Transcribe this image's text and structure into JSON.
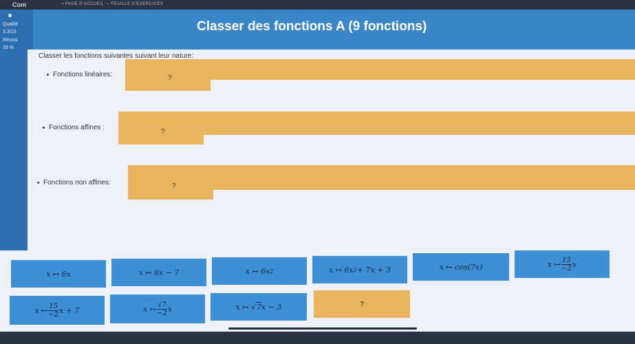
{
  "topbar": {
    "app": "Com",
    "crumb": "▪ PAGE D'ACCUEIL  —  FEUILLE D'EXERCICES"
  },
  "sidebar": {
    "label1": "Qualité",
    "value1": "3.3/10",
    "label2": "Réussi",
    "value2": "33 %"
  },
  "header": {
    "title": "Classer des fonctions A (9 fonctions)"
  },
  "instructions": "Classer les fonctions suivantes suivant leur nature:",
  "categories": [
    {
      "label": "Fonctions linéaires:",
      "placeholder": "?"
    },
    {
      "label": "Fonctions affines :",
      "placeholder": "?"
    },
    {
      "label": "Fonctions non affines:",
      "placeholder": "?"
    }
  ],
  "tiles": [
    {
      "text": "x ↦ 6x"
    },
    {
      "text": "x ↦ 6x − 7"
    },
    {
      "prefix": "x ↦ 6x",
      "sup": "2"
    },
    {
      "prefix": "x ↦ 6x",
      "sup": "2",
      "suffix": " + 7x + 3"
    },
    {
      "text": "x ↦ cos(7x)"
    },
    {
      "prefix": "x ↦ ",
      "num": "15",
      "den": "−2",
      "suffix": "x"
    },
    {
      "prefix": "x ↦ ",
      "num": "15",
      "den": "−2",
      "suffix": "x + 7"
    },
    {
      "prefix": "x ↦ ",
      "num": "√7",
      "den": "−2",
      "suffix": "x"
    },
    {
      "prefix": "x ↦ √",
      "rad": "7",
      "suffix": "x − 3"
    },
    {
      "text": "?"
    }
  ],
  "colors": {
    "header": "#3b86c9",
    "sidebar": "#2b6fb0",
    "tile": "#3d8fd6",
    "dropzone": "#e8b45c"
  }
}
